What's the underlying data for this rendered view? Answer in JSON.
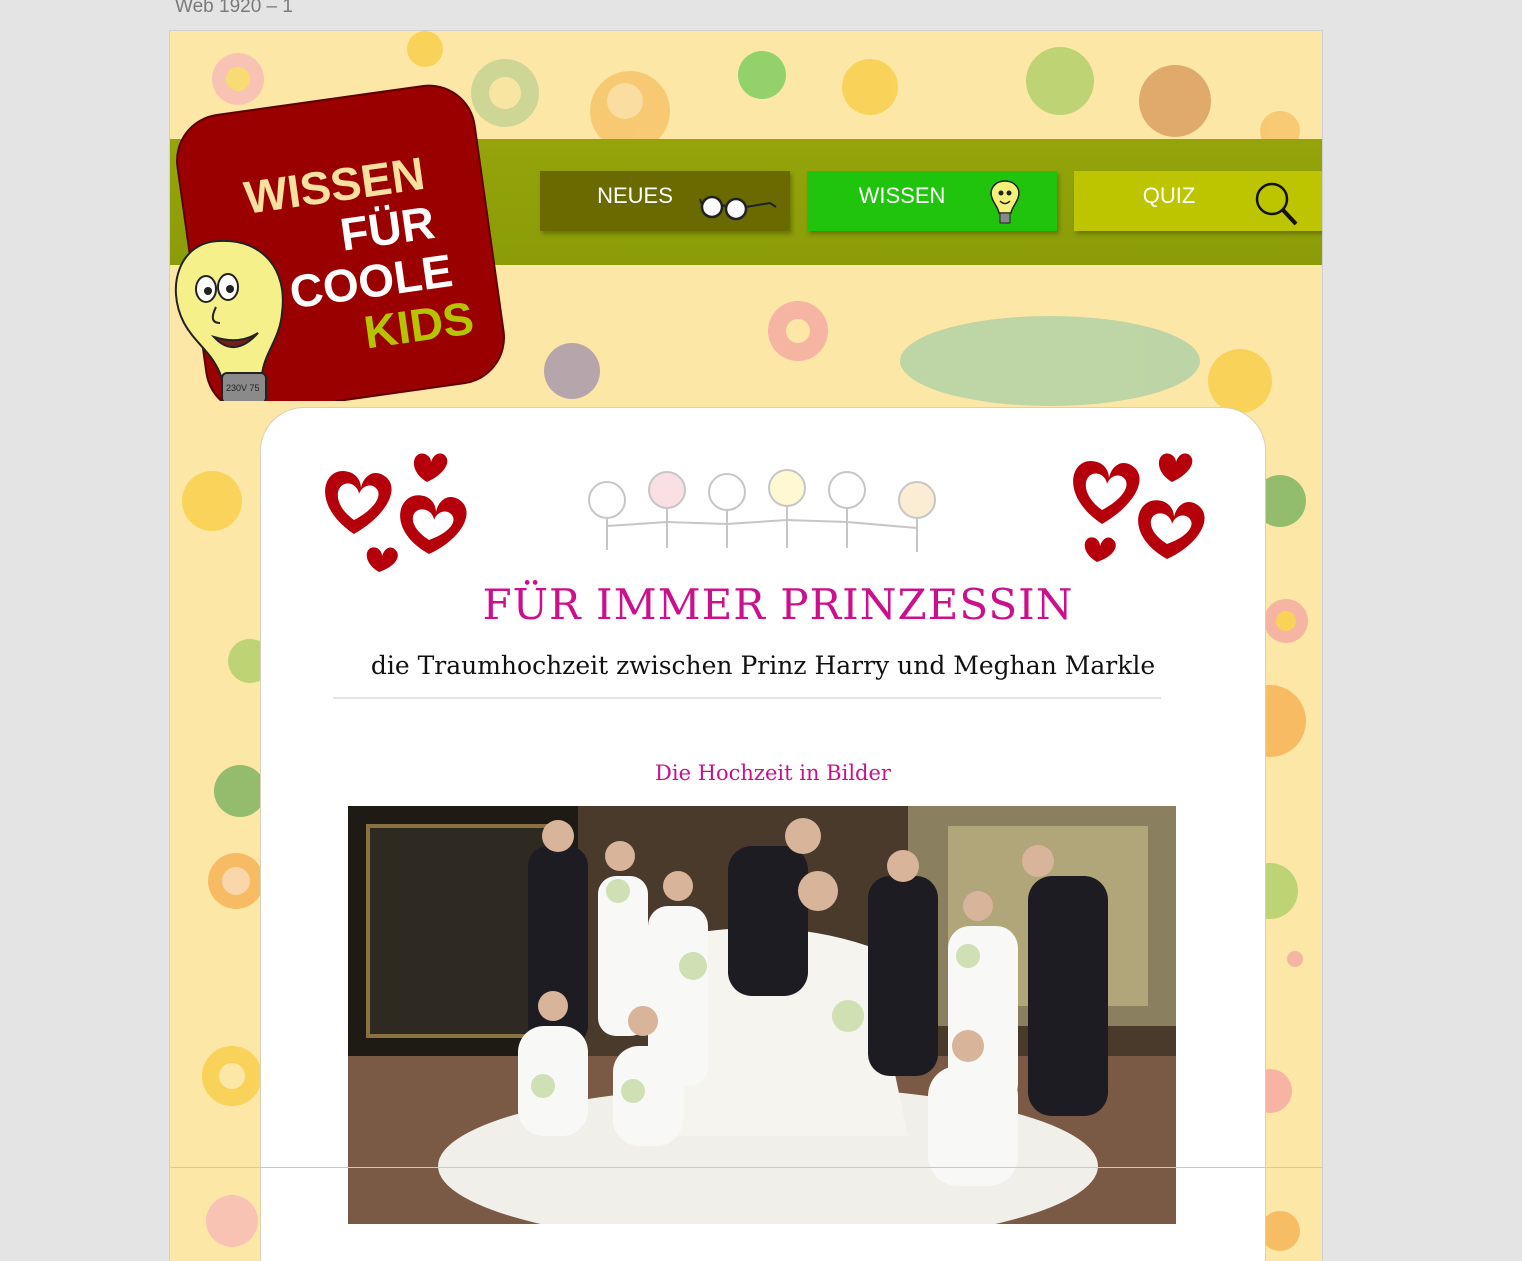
{
  "artboard_label": "Web 1920 – 1",
  "logo": {
    "line1": "WISSEN",
    "line2": "FÜR",
    "line3": "COOLE",
    "line4": "KIDS",
    "bulb_text": "230V 75"
  },
  "nav": {
    "items": [
      {
        "label": "NEUES",
        "icon": "glasses-icon",
        "color": "#6a6a00"
      },
      {
        "label": "WISSEN",
        "icon": "lightbulb-icon",
        "color": "#20c40c"
      },
      {
        "label": "QUIZ",
        "icon": "magnifier-icon",
        "color": "#bdc400"
      }
    ]
  },
  "article": {
    "title": "FÜR IMMER PRINZESSIN",
    "subtitle": "die Traumhochzeit zwischen Prinz Harry und Meghan Markle",
    "section_title": "Die Hochzeit in Bilder",
    "image": "wedding-group-photo"
  },
  "colors": {
    "background": "#fde7a6",
    "nav_bar": "#94a40a",
    "logo_red": "#9b0000",
    "title_pink": "#cc0f8c",
    "heart_red": "#b5000c"
  }
}
